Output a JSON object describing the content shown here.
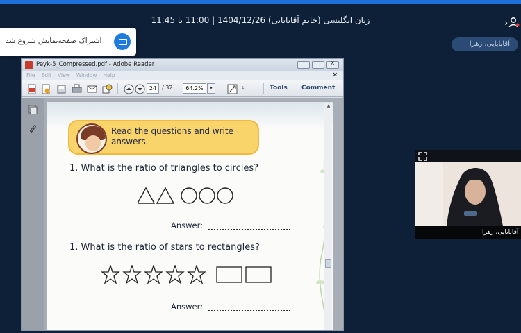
{
  "session": {
    "title": "زبان انگلیسی (خانم آقابابایی) 1404/12/26 | 11:00 تا 11:45",
    "user_chip": "آقابابایی، زهرا"
  },
  "toast": {
    "text": "اشتراک صفحه‌نمایش شروع شد"
  },
  "adobe": {
    "title": "Peyk-5_Compressed.pdf - Adobe Reader",
    "menu": [
      "File",
      "Edit",
      "View",
      "Window",
      "Help"
    ],
    "page_current": "24",
    "page_total": "/ 32",
    "zoom": "64.2%",
    "tools_label": "Tools",
    "comment_label": "Comment"
  },
  "document": {
    "instruction": "Read the questions and write answers.",
    "q1": "1. What is the ratio of triangles to circles?",
    "q2": "1. What is the ratio of stars to rectangles?",
    "answer_label": "Answer:",
    "triangles": 2,
    "circles": 3,
    "stars": 5,
    "rectangles": 2
  },
  "video": {
    "participant": "آقابابایی، زهرا"
  },
  "colors": {
    "background": "#0e2038",
    "accent": "#1e6fd9",
    "banner": "#f9d46a"
  }
}
